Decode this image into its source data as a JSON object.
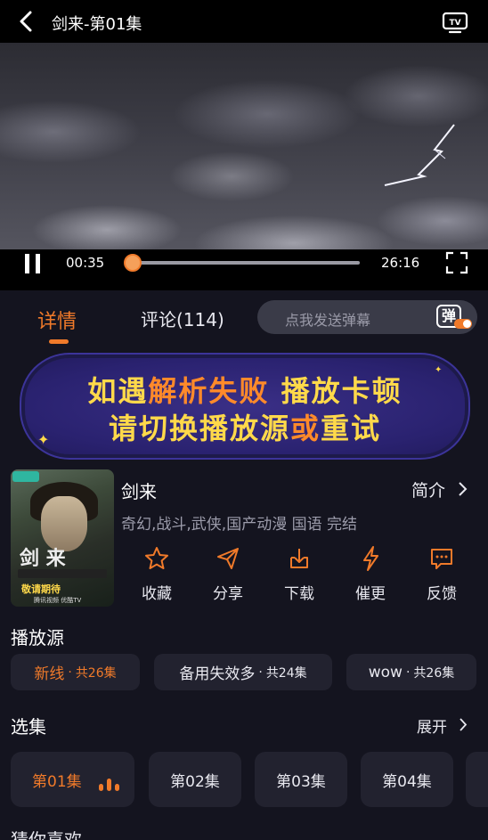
{
  "header": {
    "title": "剑来-第01集"
  },
  "player": {
    "current_time": "00:35",
    "total_time": "26:16",
    "progress": 0.022
  },
  "tabs": {
    "detail": "详情",
    "comments": "评论(114)"
  },
  "danmaku": {
    "placeholder": "点我发送弹幕",
    "icon_char": "弹"
  },
  "banner": {
    "line1": [
      "如遇",
      "解析失败",
      " ",
      "播放卡顿"
    ],
    "line2": [
      "请",
      "切换播放源",
      "或",
      "重试"
    ]
  },
  "poster": {
    "big_text": "剑 来",
    "sub_text": "敬请期待",
    "logos": "腾讯视频  优酷TV"
  },
  "show": {
    "name": "剑来",
    "intro_label": "简介",
    "tags": "奇幻,战斗,武侠,国产动漫 国语 完结"
  },
  "actions": [
    {
      "icon": "star-icon",
      "label": "收藏"
    },
    {
      "icon": "share-icon",
      "label": "分享"
    },
    {
      "icon": "download-icon",
      "label": "下载"
    },
    {
      "icon": "lightning-icon",
      "label": "催更"
    },
    {
      "icon": "feedback-icon",
      "label": "反馈"
    }
  ],
  "sources": {
    "title": "播放源",
    "items": [
      {
        "name": "新线",
        "count": "共26集"
      },
      {
        "name": "备用失效多",
        "count": "共24集"
      },
      {
        "name": "wow",
        "count": "共26集"
      }
    ]
  },
  "episodes": {
    "title": "选集",
    "expand_label": "展开",
    "items": [
      "第01集",
      "第02集",
      "第03集",
      "第04集"
    ]
  },
  "next_section": {
    "title": "猜你喜欢"
  },
  "colors": {
    "accent": "#f07a2a",
    "background": "#14141f",
    "card": "#22222f"
  }
}
